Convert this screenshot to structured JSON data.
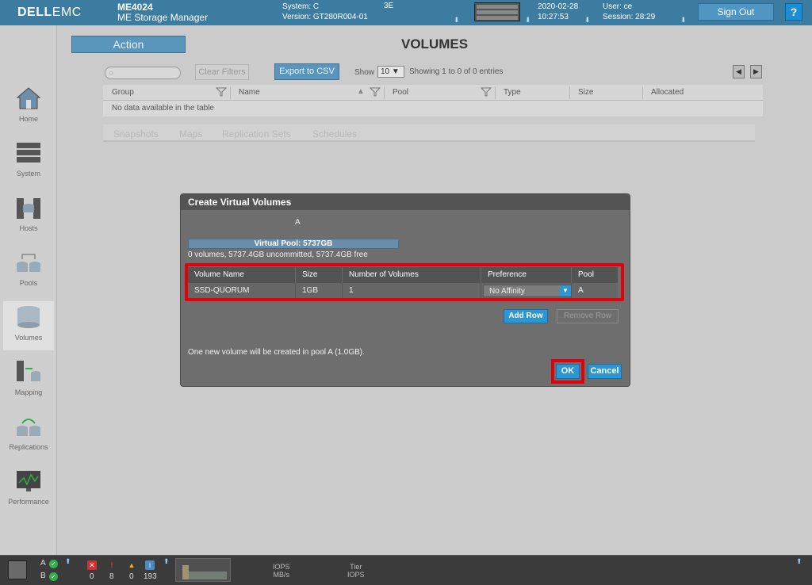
{
  "header": {
    "brand": "DELL",
    "brand_suffix": "EMC",
    "model": "ME4024",
    "product": "ME Storage Manager",
    "system_line": "System: C",
    "system_extra": "3E",
    "version_line": "Version: GT280R004-01",
    "date": "2020-02-28",
    "time": "10:27:53",
    "user_line": "User: ce",
    "session_line": "Session: 28:29",
    "sign_out_label": "Sign Out",
    "help_label": "?"
  },
  "sidebar": {
    "items": [
      {
        "label": "Home",
        "icon": "home-icon"
      },
      {
        "label": "System",
        "icon": "system-icon"
      },
      {
        "label": "Hosts",
        "icon": "hosts-icon"
      },
      {
        "label": "Pools",
        "icon": "pools-icon"
      },
      {
        "label": "Volumes",
        "icon": "volumes-icon"
      },
      {
        "label": "Mapping",
        "icon": "mapping-icon"
      },
      {
        "label": "Replications",
        "icon": "replications-icon"
      },
      {
        "label": "Performance",
        "icon": "performance-icon"
      }
    ],
    "active": "Volumes"
  },
  "main": {
    "action_label": "Action",
    "page_title": "VOLUMES",
    "search_placeholder": "",
    "clear_filters_label": "Clear Filters",
    "export_label": "Export to CSV",
    "show_label": "Show",
    "show_value": "10 ▼",
    "showing_text": "Showing 1 to 0 of 0 entries",
    "columns": [
      "Group",
      "Name",
      "Pool",
      "Type",
      "Size",
      "Allocated"
    ],
    "empty_text": "No data available in the table",
    "subtabs": [
      "Snapshots",
      "Maps",
      "Replication Sets",
      "Schedules"
    ]
  },
  "dialog": {
    "title": "Create Virtual Volumes",
    "pool_letter": "A",
    "pool_bar_label": "Virtual Pool: 5737GB",
    "pool_stats": "0 volumes, 5737.4GB uncommitted, 5737.4GB free",
    "columns": [
      "Volume Name",
      "Size",
      "Number of Volumes",
      "Preference",
      "Pool"
    ],
    "row": {
      "volume_name": "SSD-QUORUM",
      "size": "1GB",
      "number": "1",
      "preference": "No Affinity",
      "pool": "A"
    },
    "add_row_label": "Add Row",
    "remove_row_label": "Remove Row",
    "summary": "One new volume will be created in pool A (1.0GB).",
    "ok_label": "OK",
    "cancel_label": "Cancel"
  },
  "footer": {
    "controller_a": "A",
    "controller_b": "B",
    "critical_count": "0",
    "error_count": "8",
    "warning_count": "0",
    "info_count": "193",
    "iops_label": "IOPS",
    "mbs_label": "MB/s",
    "tier_label": "Tier",
    "tier_iops_label": "IOPS"
  },
  "colors": {
    "header_bg": "#3d7ca1",
    "accent": "#2a96d3",
    "highlight": "#e3000b"
  }
}
